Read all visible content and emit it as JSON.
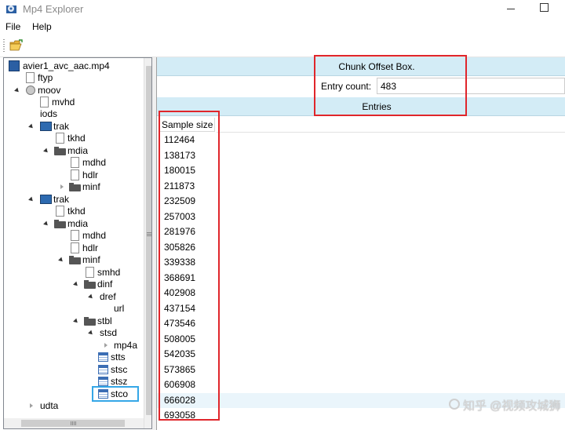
{
  "window": {
    "title": "Mp4 Explorer"
  },
  "menu": {
    "file": "File",
    "help": "Help"
  },
  "toolbar": {
    "open_icon": "open-folder-icon"
  },
  "tree": {
    "root": "avier1_avc_aac.mp4",
    "ftyp": "ftyp",
    "moov": "moov",
    "mvhd": "mvhd",
    "iods": "iods",
    "trak1": "trak",
    "tkhd1": "tkhd",
    "mdia1": "mdia",
    "mdhd1": "mdhd",
    "hdlr1": "hdlr",
    "minf1": "minf",
    "trak2": "trak",
    "tkhd2": "tkhd",
    "mdia2": "mdia",
    "mdhd2": "mdhd",
    "hdlr2": "hdlr",
    "minf2": "minf",
    "smhd": "smhd",
    "dinf": "dinf",
    "dref": "dref",
    "url": "url",
    "stbl": "stbl",
    "stsd": "stsd",
    "mp4a": "mp4a",
    "stts": "stts",
    "stsc": "stsc",
    "stsz": "stsz",
    "stco": "stco",
    "udta": "udta"
  },
  "box": {
    "title": "Chunk Offset Box.",
    "entry_count_label": "Entry count:",
    "entry_count_value": "483",
    "entries_label": "Entries",
    "column_header": "Sample size",
    "rows": [
      "112464",
      "138173",
      "180015",
      "211873",
      "232509",
      "257003",
      "281976",
      "305826",
      "339338",
      "368691",
      "402908",
      "437154",
      "473546",
      "508005",
      "542035",
      "573865",
      "606908",
      "666028",
      "693058"
    ],
    "highlighted_row": "666028"
  },
  "watermark": "知乎 @视频攻城狮",
  "colors": {
    "band": "#d3ecf6",
    "annotation_red": "#e0262b",
    "selection_blue": "#35a7e7"
  }
}
